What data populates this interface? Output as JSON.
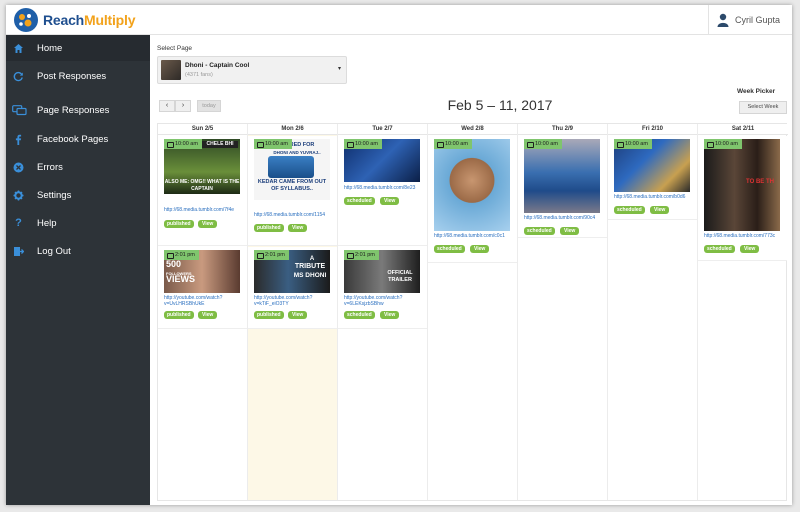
{
  "brand": {
    "name_part1": "Reach",
    "name_part2": "Multiply"
  },
  "user": {
    "name": "Cyril Gupta"
  },
  "nav": [
    {
      "label": "Home",
      "icon": "home-icon",
      "active": true
    },
    {
      "label": "Post Responses",
      "icon": "refresh-icon"
    },
    {
      "label": "Page Responses",
      "icon": "chat-icon"
    },
    {
      "label": "Facebook Pages",
      "icon": "facebook-icon"
    },
    {
      "label": "Errors",
      "icon": "error-icon"
    },
    {
      "label": "Settings",
      "icon": "gear-icon"
    },
    {
      "label": "Help",
      "icon": "question-icon"
    },
    {
      "label": "Log Out",
      "icon": "logout-icon"
    }
  ],
  "page_select": {
    "label": "Select Page",
    "name": "Dhoni - Captain Cool",
    "fans": "(4371 fans)"
  },
  "toolbar": {
    "prev": "‹",
    "next": "›",
    "today": "today",
    "title": "Feb 5 – 11, 2017",
    "week_label": "Week Picker",
    "week_button": "Select Week"
  },
  "days": [
    "Sun 2/5",
    "Mon 2/6",
    "Tue 2/7",
    "Wed 2/8",
    "Thu 2/9",
    "Fri 2/10",
    "Sat 2/11"
  ],
  "posts": {
    "sun1": {
      "time": "10:00 am",
      "caption_top": "CHELE BHI",
      "caption_bottom": "ALSO ME: OMG!! WHAT IS THE CAPTAIN",
      "link": "http://68.media.tumblr.com/7f4e",
      "status": "published",
      "view": "View"
    },
    "sun2": {
      "time": "2:01 pm",
      "caption_top": "500",
      "caption_mid": "FOLLOWERS",
      "caption_bottom": "VIEWS",
      "link1": "http://youtube.com/watch?",
      "link2": "v=UvLHRSBhUkE",
      "status": "published",
      "view": "View"
    },
    "mon1": {
      "time": "10:00 am",
      "caption_top": "RED FOR",
      "caption_top2": "DHONI AND YUVRAJ..",
      "caption_bottom": "KEDAR CAME FROM OUT OF SYLLABUS..",
      "link": "http://68.media.tumblr.com/1154",
      "status": "published",
      "view": "View"
    },
    "mon2": {
      "time": "2:01 pm",
      "caption_top": "A",
      "caption_mid": "TRIBUTE",
      "caption_bottom": "MS DHONI",
      "link1": "http://youtube.com/watch?",
      "link2": "v=kTiF_eiO3TY",
      "status": "published",
      "view": "View"
    },
    "tue1": {
      "time": "10:00 am",
      "link": "http://68.media.tumblr.com/8e23",
      "status": "scheduled",
      "view": "View"
    },
    "tue2": {
      "time": "2:01 pm",
      "caption_mid": "OFFICIAL",
      "caption_bottom": "TRAILER",
      "link1": "http://youtube.com/watch?",
      "link2": "v=6LEKsjzbSBhw",
      "status": "scheduled",
      "view": "View"
    },
    "wed1": {
      "time": "10:00 am",
      "link": "http://68.media.tumblr.com/c0c1",
      "status": "scheduled",
      "view": "View"
    },
    "thu1": {
      "time": "10:00 am",
      "link": "http://68.media.tumblr.com/90c4",
      "status": "scheduled",
      "view": "View"
    },
    "fri1": {
      "time": "10:00 am",
      "link": "http://68.media.tumblr.com/b0d6",
      "status": "scheduled",
      "view": "View"
    },
    "sat1": {
      "time": "10:00 am",
      "caption": "TO BE TH",
      "link": "http://68.media.tumblr.com/773c",
      "status": "scheduled",
      "view": "View"
    }
  }
}
